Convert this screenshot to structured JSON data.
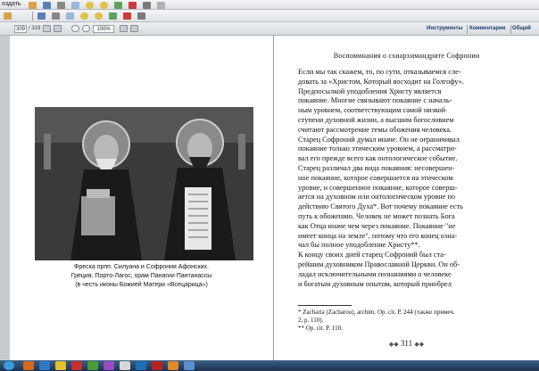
{
  "toolbar": {
    "create_label": "оздать",
    "page_current": "309",
    "page_total": "/ 319",
    "zoom": "100%",
    "tools_tab": "Инструменты",
    "comments_tab": "Комментарии",
    "shared_tab": "Общий"
  },
  "left_page": {
    "caption_lines": [
      "Фреска прпп. Силуана и Софрония Афонских.",
      "Греция, Порто-Лагос, храм Панагии Пантанассы",
      "(в честь иконы Божией Матери «Всецарица»)"
    ]
  },
  "right_page": {
    "running_header": "Воспоминания о схиархимандрите Софронии",
    "lines": [
      "Если мы так скажем, то, по сути, отказываемся сле-",
      "довать за «Христом, Который восходит на Голгофу».",
      "    Предпосылкой уподобления Христу является",
      "покаяние. Многие связывают покаяние с началь-",
      "ным уровнем, соответствующим самой низкой",
      "ступени духовной жизни, а высшим богословием",
      "считают рассмотрение темы обожения человека.",
      "Старец Софроний думал иначе. Он не ограничивал",
      "покаяние только этическим уровнем, а рассматри-",
      "вал его прежде всего как онтологическое событие.",
      "Старец различал два вида покаяния: несовершен-",
      "ное покаяние, которое совершается на этическом",
      "уровне, и совершенное покаяние, которое соверш-",
      "ается на духовном или онтологическом уровне по",
      "действию Святого Духа*. Вот почему покаяние есть",
      "путь к обожению. Человек не может познать Бога",
      "как Отца иначе чем через покаяние. Покаяние \"не",
      "имеет конца на земле\", потому что его конец озна-",
      "чал бы полное уподобление Христу**.",
      "    К концу своих дней старец Софроний был ста-",
      "рейшим духовником Православной Церкви. Он об-",
      "ладал исключительными познаниями о человеке",
      "и богатым духовным опытом, который приобрел"
    ],
    "footnotes": [
      "*   Zacharia (Zacharou), archim. Op. cit. P. 244 (также примеч.",
      "    2, p. 110).",
      "**  Op. cit. P. 110."
    ],
    "page_number": "311"
  },
  "colors": {
    "toolbar_bg": "#e6e8eb",
    "doc_bg": "#c7cbd0",
    "taskbar": "#24405f"
  }
}
